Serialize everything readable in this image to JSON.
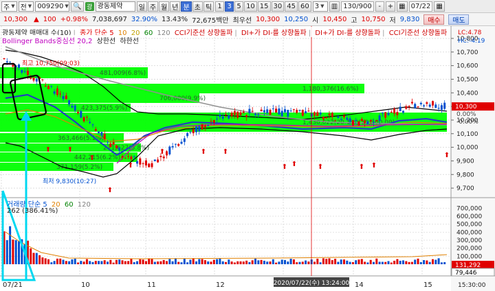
{
  "toolbar": {
    "market": "주",
    "period": "전",
    "code": "009290",
    "name": "광동제약",
    "units": [
      "일",
      "주",
      "월",
      "년",
      "분",
      "초",
      "틱"
    ],
    "active_unit": "분",
    "minutes": [
      "1",
      "3",
      "5",
      "10",
      "15",
      "30",
      "45",
      "60"
    ],
    "active_minute": "3",
    "interval_value": "3",
    "count": "130/900",
    "date": "07/22"
  },
  "quote": {
    "price": "10,300",
    "change": "100",
    "change_pct": "+0.98%",
    "volume": "7,038,697",
    "ratio1": "32.90%",
    "ratio2": "13.43%",
    "amount": "72,675백만",
    "best_label": "최우선",
    "best_ask": "10,300",
    "best_bid": "10,250",
    "high_label": "시",
    "high": "10,450",
    "high2_label": "고",
    "high2": "10,750",
    "low_label": "저",
    "low": "9,830",
    "buy_label": "매수",
    "sell_label": "매도"
  },
  "legend_price": {
    "title": "광동제약 매매대 수(10)",
    "ma": "종가 단순 5",
    "ma_periods": [
      "10",
      "20",
      "60",
      "120"
    ],
    "cci1": "CCI기준선 상향돌파",
    "di1": "DI+가 DI-를 상향돌파",
    "di2": "DI+가 DI-를 상향돌파",
    "cci2": "CCI기준선 상향돌파",
    "bb": "Bollinger Bands중심선 20,2",
    "limit_upper": "상한선",
    "limit_lower": "하한선"
  },
  "legend_volume": {
    "title": "거래량 단순 5",
    "periods": [
      "20",
      "60",
      "120"
    ],
    "value": "262"
  },
  "indicator_right": {
    "lc": "LC:4.78",
    "hc": "HC:-4.19"
  },
  "price_annotations": {
    "high": "최고 10,750(09:03)",
    "low": "최저 9,830(10:27)",
    "volume_pct": "(386.41%)"
  },
  "volume_profile": [
    {
      "label": "481,009(6.8%)"
    },
    {
      "label": "1,180,376(16.6%)"
    },
    {
      "label": "706,080(9.9%)"
    },
    {
      "label": "423,375(5.9%)"
    },
    {
      "label": "1,430,022(20.1%)(10,300.00)"
    },
    {
      "label": "363,466(5.1%)"
    },
    {
      "label": "271,627(3.8%)"
    },
    {
      "label": "442,215(6.2%)"
    },
    {
      "label": "371,159(5.2%)"
    }
  ],
  "price_axis": {
    "labels": [
      "10,800",
      "10,700",
      "10,600",
      "10,500",
      "10,400",
      "10,300",
      "10,200",
      "10,100",
      "10,000",
      "9,900",
      "9,800",
      "9,700"
    ],
    "current": "10,300",
    "pct_upper": "0.00%",
    "pct_lower": "-0.00%"
  },
  "volume_axis": {
    "labels": [
      "700,000",
      "600,000",
      "500,000",
      "400,000",
      "300,000",
      "200,000",
      "100,000"
    ],
    "tag1": "131,292",
    "tag2": "79,446"
  },
  "time_axis": {
    "labels": [
      "07/21",
      "10",
      "11",
      "12",
      "13",
      "14",
      "15"
    ],
    "crosshair": "2020/07/22(수) 13:24:00",
    "right": "15:30:00"
  },
  "chart_data": {
    "type": "candlestick",
    "colors": {
      "up": "#e00000",
      "down": "#0050d0",
      "profile": "#00ff00",
      "bb": "#000000",
      "ma5": "#2040c0",
      "ma20": "#e08000",
      "ma60": "#909090",
      "ma120": "#c000c0"
    },
    "ylim": [
      9650,
      10820
    ],
    "vol_ylim": [
      0,
      780000
    ]
  }
}
